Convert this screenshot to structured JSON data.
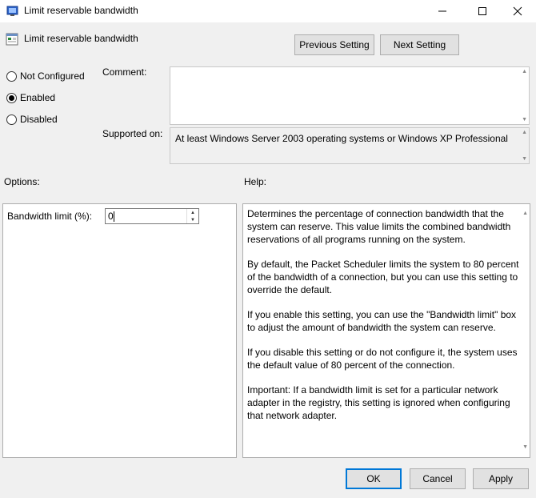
{
  "window": {
    "title": "Limit reservable bandwidth",
    "icon": "policy-settings-icon"
  },
  "header": {
    "title": "Limit reservable bandwidth",
    "icon": "policy-settings-icon"
  },
  "nav": {
    "previous_label": "Previous Setting",
    "next_label": "Next Setting"
  },
  "state": {
    "options": [
      {
        "label": "Not Configured",
        "checked": false
      },
      {
        "label": "Enabled",
        "checked": true
      },
      {
        "label": "Disabled",
        "checked": false
      }
    ]
  },
  "comment": {
    "label": "Comment:",
    "value": ""
  },
  "supported": {
    "label": "Supported on:",
    "value": "At least Windows Server 2003 operating systems or Windows XP Professional"
  },
  "options_section": {
    "label": "Options:",
    "bandwidth_label": "Bandwidth limit (%):",
    "bandwidth_value": "0"
  },
  "help_section": {
    "label": "Help:",
    "paragraphs": [
      "Determines the percentage of connection bandwidth that the system can reserve. This value limits the combined bandwidth reservations of all programs running on the system.",
      "By default, the Packet Scheduler limits the system to 80 percent of the bandwidth of a connection, but you can use this setting to override the default.",
      "If you enable this setting, you can use the \"Bandwidth limit\" box to adjust the amount of bandwidth the system can reserve.",
      "If you disable this setting or do not configure it, the system uses the default value of 80 percent of the connection.",
      "Important: If a bandwidth limit is set for a particular network adapter in the registry, this setting is ignored when configuring that network adapter."
    ]
  },
  "footer": {
    "ok_label": "OK",
    "cancel_label": "Cancel",
    "apply_label": "Apply"
  },
  "colors": {
    "window_bg": "#f0f0f0",
    "accent": "#0078d7"
  }
}
